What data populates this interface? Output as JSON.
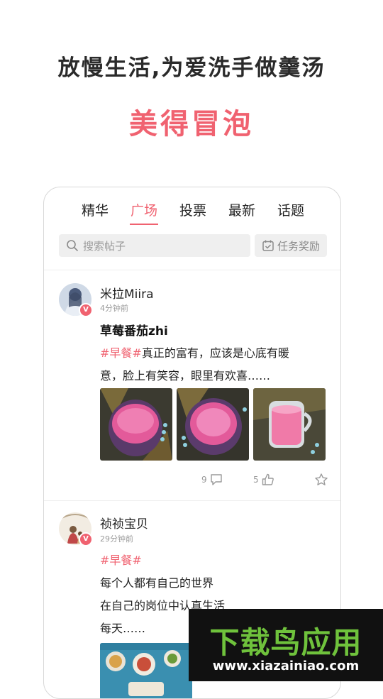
{
  "header": {
    "headline": "放慢生活,为爱洗手做羹汤",
    "subheadline": "美得冒泡"
  },
  "tabs": [
    {
      "label": "精华",
      "active": false
    },
    {
      "label": "广场",
      "active": true
    },
    {
      "label": "投票",
      "active": false
    },
    {
      "label": "最新",
      "active": false
    },
    {
      "label": "话题",
      "active": false
    }
  ],
  "search": {
    "placeholder": "搜索帖子"
  },
  "task_button": {
    "label": "任务奖励"
  },
  "posts": [
    {
      "username": "米拉Miira",
      "time": "4分钟前",
      "title": "草莓番茄zhi",
      "tag": "#早餐#",
      "line1_rest": "真正的富有，应该是心底有暖",
      "line2": "意，脸上有笑容，眼里有欢喜……",
      "comments": "9",
      "likes": "5"
    },
    {
      "username": "祯祯宝贝",
      "time": "29分钟前",
      "tag": "#早餐#",
      "line1": "每个人都有自己的世界",
      "line2": "在自己的岗位中认真生活",
      "line3": "每天……"
    }
  ],
  "watermark": {
    "title": "下载鸟应用",
    "url": "www.xiazainiao.com"
  },
  "colors": {
    "accent": "#f06270",
    "text": "#222222",
    "muted": "#999999"
  },
  "icons": [
    "search-icon",
    "task-calendar-icon",
    "comment-icon",
    "thumbs-up-icon",
    "star-icon",
    "verified-badge-icon"
  ]
}
